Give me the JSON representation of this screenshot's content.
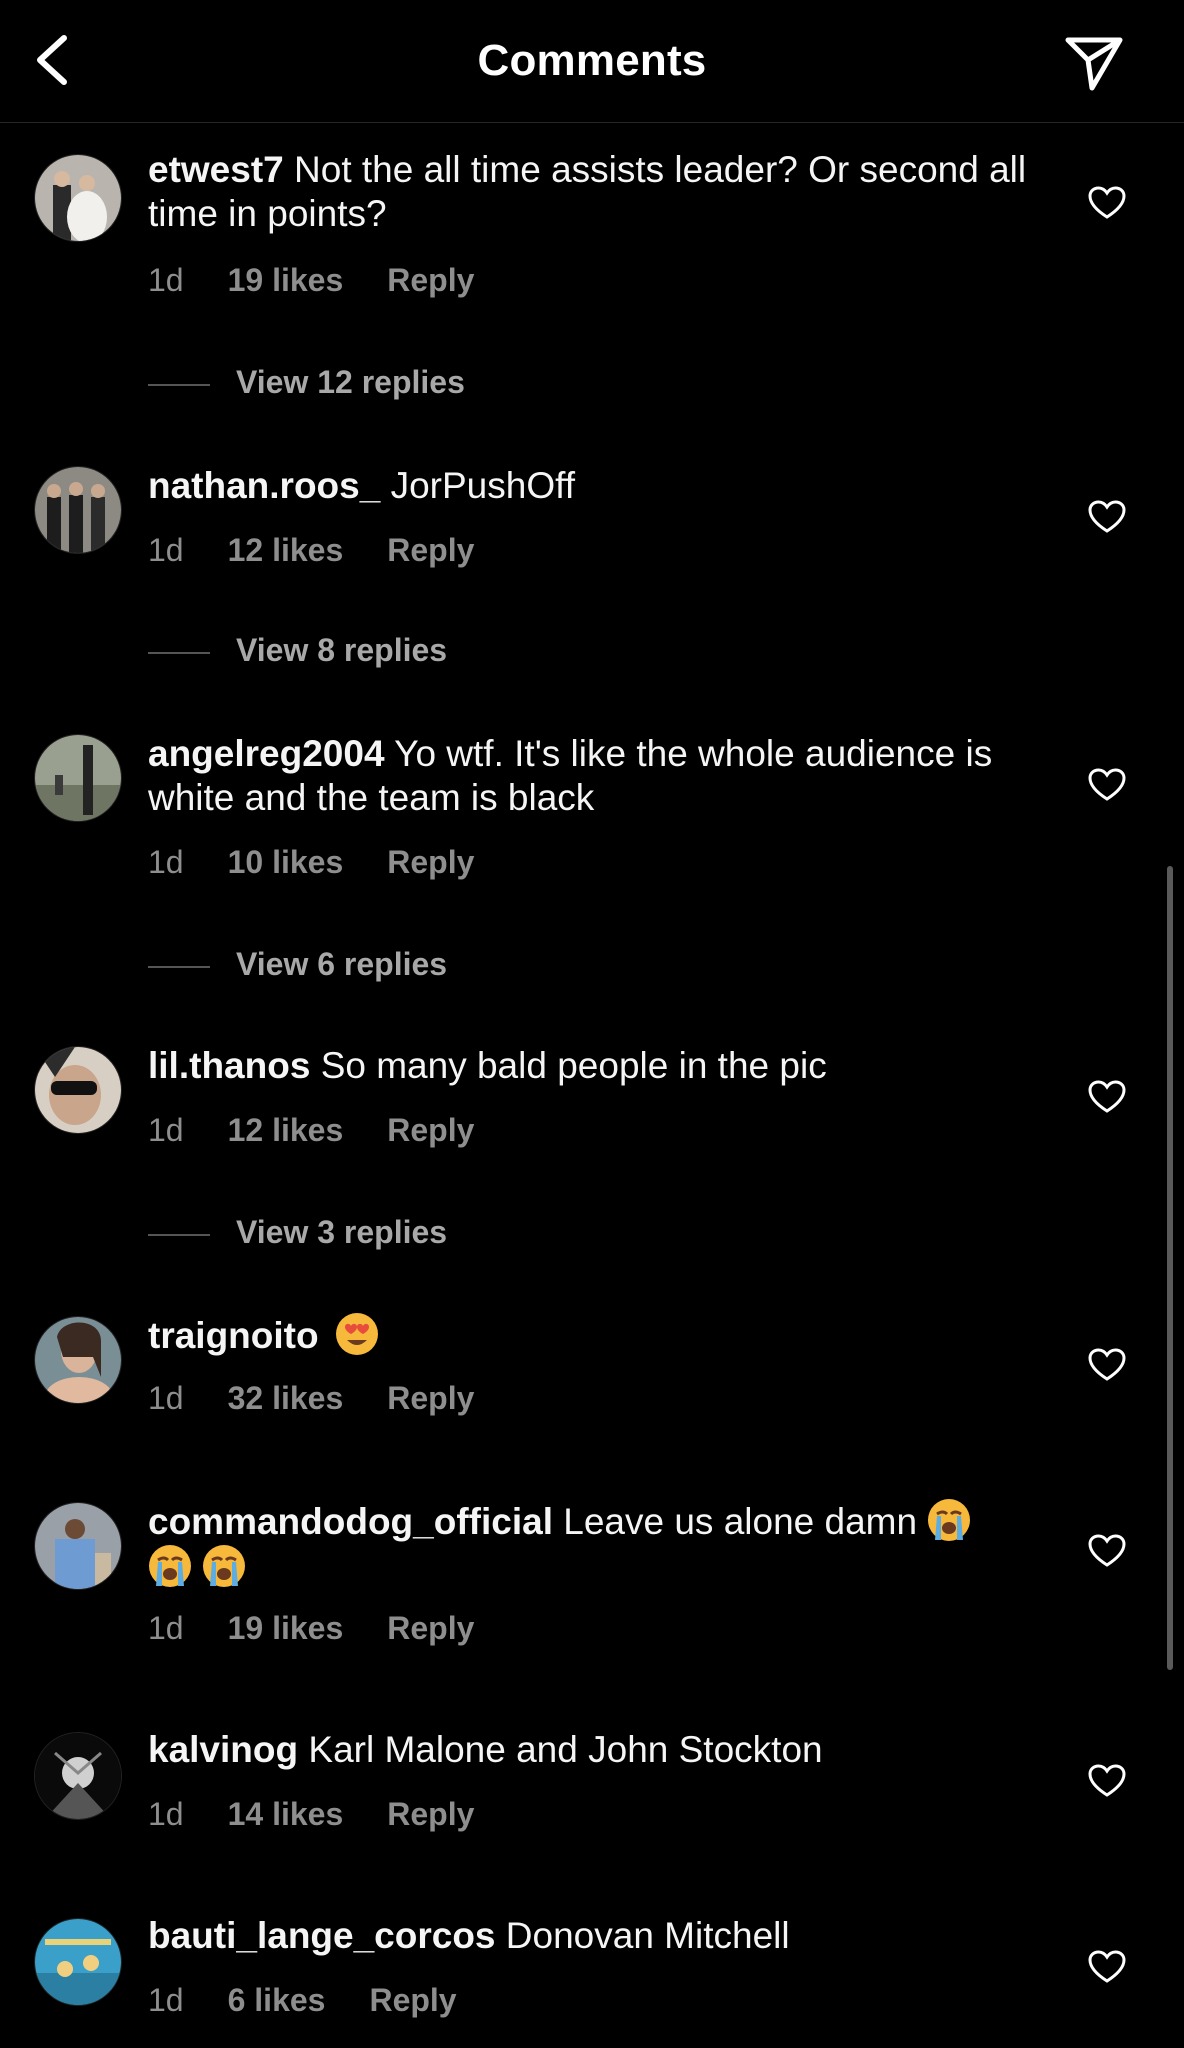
{
  "header": {
    "title": "Comments",
    "back_icon": "chevron-left-icon",
    "send_icon": "paper-plane-icon"
  },
  "comments": [
    {
      "user": "etwest7",
      "text": "Not the all time assists leader? Or second all time in points?",
      "time": "1d",
      "likes": "19 likes",
      "reply": "Reply",
      "view_replies": "View 12 replies"
    },
    {
      "user": "nathan.roos_",
      "text": "JorPushOff",
      "time": "1d",
      "likes": "12 likes",
      "reply": "Reply",
      "view_replies": "View 8 replies"
    },
    {
      "user": "angelreg2004",
      "text": "Yo wtf. It's like the whole audience is white and the team is black",
      "time": "1d",
      "likes": "10 likes",
      "reply": "Reply",
      "view_replies": "View 6 replies"
    },
    {
      "user": "lil.thanos",
      "text": "So many bald people in the pic",
      "time": "1d",
      "likes": "12 likes",
      "reply": "Reply",
      "view_replies": "View 3 replies"
    },
    {
      "user": "traignoito",
      "text": "",
      "emoji": "heart-eyes-emoji",
      "time": "1d",
      "likes": "32 likes",
      "reply": "Reply"
    },
    {
      "user": "commandodog_official",
      "text": "Leave us alone damn",
      "emoji": "loudly-crying-emoji",
      "time": "1d",
      "likes": "19 likes",
      "reply": "Reply"
    },
    {
      "user": "kalvinog",
      "text": "Karl Malone and John Stockton",
      "time": "1d",
      "likes": "14 likes",
      "reply": "Reply"
    },
    {
      "user": "bauti_lange_corcos",
      "text": "Donovan Mitchell",
      "time": "1d",
      "likes": "6 likes",
      "reply": "Reply"
    }
  ],
  "colors": {
    "background": "#000000",
    "secondary_text": "#8e8e8e"
  }
}
